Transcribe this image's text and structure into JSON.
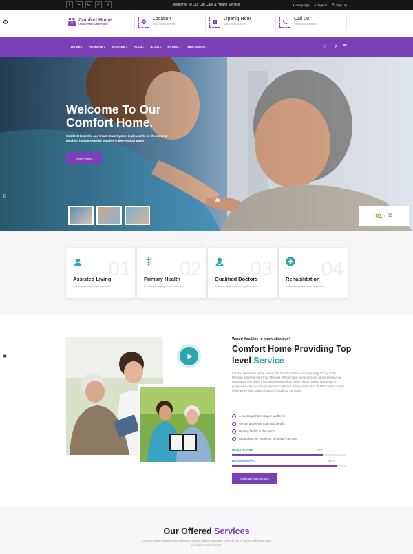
{
  "topbar": {
    "social_icons": [
      "facebook-icon",
      "rss-icon",
      "google-icon",
      "pinterest-icon",
      "instagram-icon"
    ],
    "social_glyphs": [
      "f",
      "⌁",
      "G",
      "P",
      "◎"
    ],
    "center_text": "Welcome To Our Old Care & Health Service",
    "language": "Language",
    "sign_in": "Sign In",
    "sign_up": "Sign Up"
  },
  "header": {
    "logo_title": "Comfort Home",
    "logo_subtitle": "Old & Health Care House",
    "location_title": "Location",
    "location_sub": "Your location here",
    "hours_title": "Openig Hour",
    "hours_sub": "Sat-Thi 9:00-20:00",
    "call_title": "Call Us",
    "call_sub": "+88 9875-3968-54"
  },
  "nav": {
    "items": [
      "HOME",
      "FEATURE",
      "SERVICE",
      "TEAM",
      "BLOG",
      "PAGES",
      "MEGAMENU"
    ]
  },
  "hero": {
    "title": "Welcome To Our Comfort Home.",
    "text": "Comfort Home Old and Health Care System is pleased to be the most far reaching human services supplier in the Permian Basin",
    "button": "View Project",
    "counter_current": "01",
    "counter_sep": "/",
    "counter_total": "03"
  },
  "features": [
    {
      "num": "01",
      "title": "Assisted Living",
      "sub": "Individuals cabin care services."
    },
    {
      "num": "02",
      "title": "Primary Health",
      "sub": "We are providing services for all."
    },
    {
      "num": "03",
      "title": "Qualified Doctors",
      "sub": "Doctors, skilled nurses getting care."
    },
    {
      "num": "04",
      "title": "Rehabilitation",
      "sub": "Individuals cabin care services."
    }
  ],
  "about": {
    "pre_title": "Would You Like to know about us?",
    "title_main": "Comfort Home Providing Top level ",
    "title_accent": "Service",
    "body": "Comfort Home has gladly served this County and the encompassing 27 city of the Permian Basin for more than 55 years. We've made some amazing progress since we opened our entryways in 1955 developing from a little region healing center into a prosperous 450 bed provincial medicinal focus serving more than 25,000 patients yearly. While we've seen many changes throughout the years,",
    "checks": [
      "A few things have stayed unaltered",
      "We are as yet the main hub benefit",
      "Healing facility in the district",
      "Regardless we endeavor to convey the most"
    ],
    "bars": [
      {
        "label": "HEALTH CARE",
        "percent": 80,
        "percent_text": "80%"
      },
      {
        "label": "HOUSEKEEPING",
        "percent": 92,
        "percent_text": "92%"
      }
    ],
    "button": "Make an Appointment"
  },
  "services": {
    "title_main": "Our Offered ",
    "title_accent": "Services",
    "sub": "Comfort Home supplements Glenmoor House, which is another Avery home in Corby, which has joint journeys masterminded."
  },
  "colors": {
    "primary": "#7b3fb8",
    "teal": "#2aa6ad",
    "green": "#79b53b",
    "dark": "#151515"
  }
}
